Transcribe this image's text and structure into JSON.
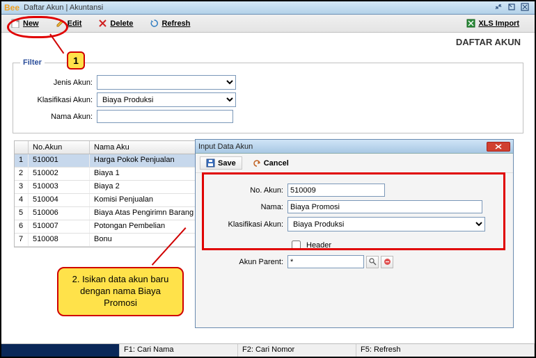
{
  "window": {
    "logo": "Bee",
    "title": "Daftar Akun | Akuntansi"
  },
  "toolbar": {
    "new_label": "New",
    "edit_label": "Edit",
    "delete_label": "Delete",
    "refresh_label": "Refresh",
    "xls_label": "XLS Import"
  },
  "page_header": "DAFTAR AKUN",
  "filter": {
    "legend": "Filter",
    "jenis_label": "Jenis Akun:",
    "jenis_value": "",
    "klas_label": "Klasifikasi Akun:",
    "klas_value": "Biaya Produksi",
    "nama_label": "Nama Akun:",
    "nama_value": ""
  },
  "grid": {
    "headers": {
      "c1": "No.Akun",
      "c2": "Nama Aku"
    },
    "rows": [
      {
        "n": "1",
        "no": "510001",
        "nama": "Harga Pokok Penjualan"
      },
      {
        "n": "2",
        "no": "510002",
        "nama": "Biaya 1"
      },
      {
        "n": "3",
        "no": "510003",
        "nama": "Biaya 2"
      },
      {
        "n": "4",
        "no": "510004",
        "nama": "Komisi Penjualan"
      },
      {
        "n": "5",
        "no": "510006",
        "nama": "Biaya Atas Pengirimn Barang"
      },
      {
        "n": "6",
        "no": "510007",
        "nama": "Potongan Pembelian"
      },
      {
        "n": "7",
        "no": "510008",
        "nama": "Bonu"
      }
    ]
  },
  "callouts": {
    "num1": "1",
    "text2": "2. Isikan data akun baru dengan nama Biaya Promosi"
  },
  "dialog": {
    "title": "Input Data Akun",
    "save_label": "Save",
    "cancel_label": "Cancel",
    "no_label": "No. Akun:",
    "no_value": "510009",
    "nama_label": "Nama:",
    "nama_value": "Biaya Promosi",
    "klas_label": "Klasifikasi Akun:",
    "klas_value": "Biaya Produksi",
    "header_label": "Header",
    "header_checked": false,
    "parent_label": "Akun Parent:",
    "parent_value": "*"
  },
  "statusbar": {
    "f1": "F1: Cari Nama",
    "f2": "F2: Cari Nomor",
    "f5": "F5: Refresh"
  }
}
